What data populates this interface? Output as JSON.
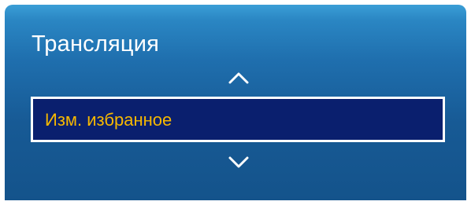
{
  "panel": {
    "title": "Трансляция",
    "selected_item": {
      "label": "Изм. избранное"
    },
    "icons": {
      "up": "chevron-up-icon",
      "down": "chevron-down-icon"
    }
  },
  "colors": {
    "panel_top": "#3a9ed6",
    "panel_bottom": "#14538b",
    "title_text": "#ffffff",
    "highlight_background": "#0a1f6e",
    "highlight_border": "#ffffff",
    "highlight_text": "#f7b800"
  }
}
